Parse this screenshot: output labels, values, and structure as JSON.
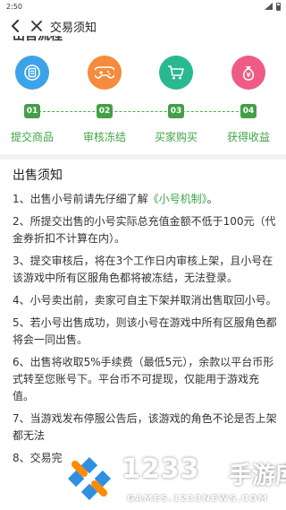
{
  "status_bar": {
    "time": "2:50"
  },
  "navbar": {
    "title": "交易须知"
  },
  "section_heading_cut": "出售流程",
  "steps": [
    {
      "num": "01",
      "label": "提交商品",
      "icon": "receipt-icon",
      "color": "#3da3e8"
    },
    {
      "num": "02",
      "label": "审核冻结",
      "icon": "gamepad-icon",
      "color": "#f58b3c"
    },
    {
      "num": "03",
      "label": "买家购买",
      "icon": "cart-icon",
      "color": "#28b98f"
    },
    {
      "num": "04",
      "label": "获得收益",
      "icon": "money-bag-icon",
      "color": "#ef5c83"
    }
  ],
  "notice": {
    "title": "出售须知",
    "items": [
      {
        "text": "1、出售小号前请先仔细了解",
        "link": "《小号机制》",
        "suffix": "。"
      },
      {
        "text": "2、所提交出售的小号实际总充值金额不低于100元（代金券折扣不计算在内）。"
      },
      {
        "text": "3、提交审核后，将在3个工作日内审核上架，且小号在该游戏中所有区服角色都将被冻结，无法登录。"
      },
      {
        "text": "4、小号卖出前，卖家可自主下架并取消出售取回小号。"
      },
      {
        "text": "5、若小号出售成功，则该小号在游戏中所有区服角色都将会一同出售。"
      },
      {
        "text": "6、出售将收取5%手续费（最低5元），余款以平台币形式转至您账号下。平台币不可提现，仅能用于游戏充值。"
      },
      {
        "text": "7、当游戏发布停服公告后，该游戏的角色不论是否上架都无法"
      },
      {
        "text": "8、交易完"
      }
    ]
  },
  "watermark": {
    "number": "1233",
    "name": "手游库",
    "domain": "GAMES.1233NEWS.COM"
  }
}
